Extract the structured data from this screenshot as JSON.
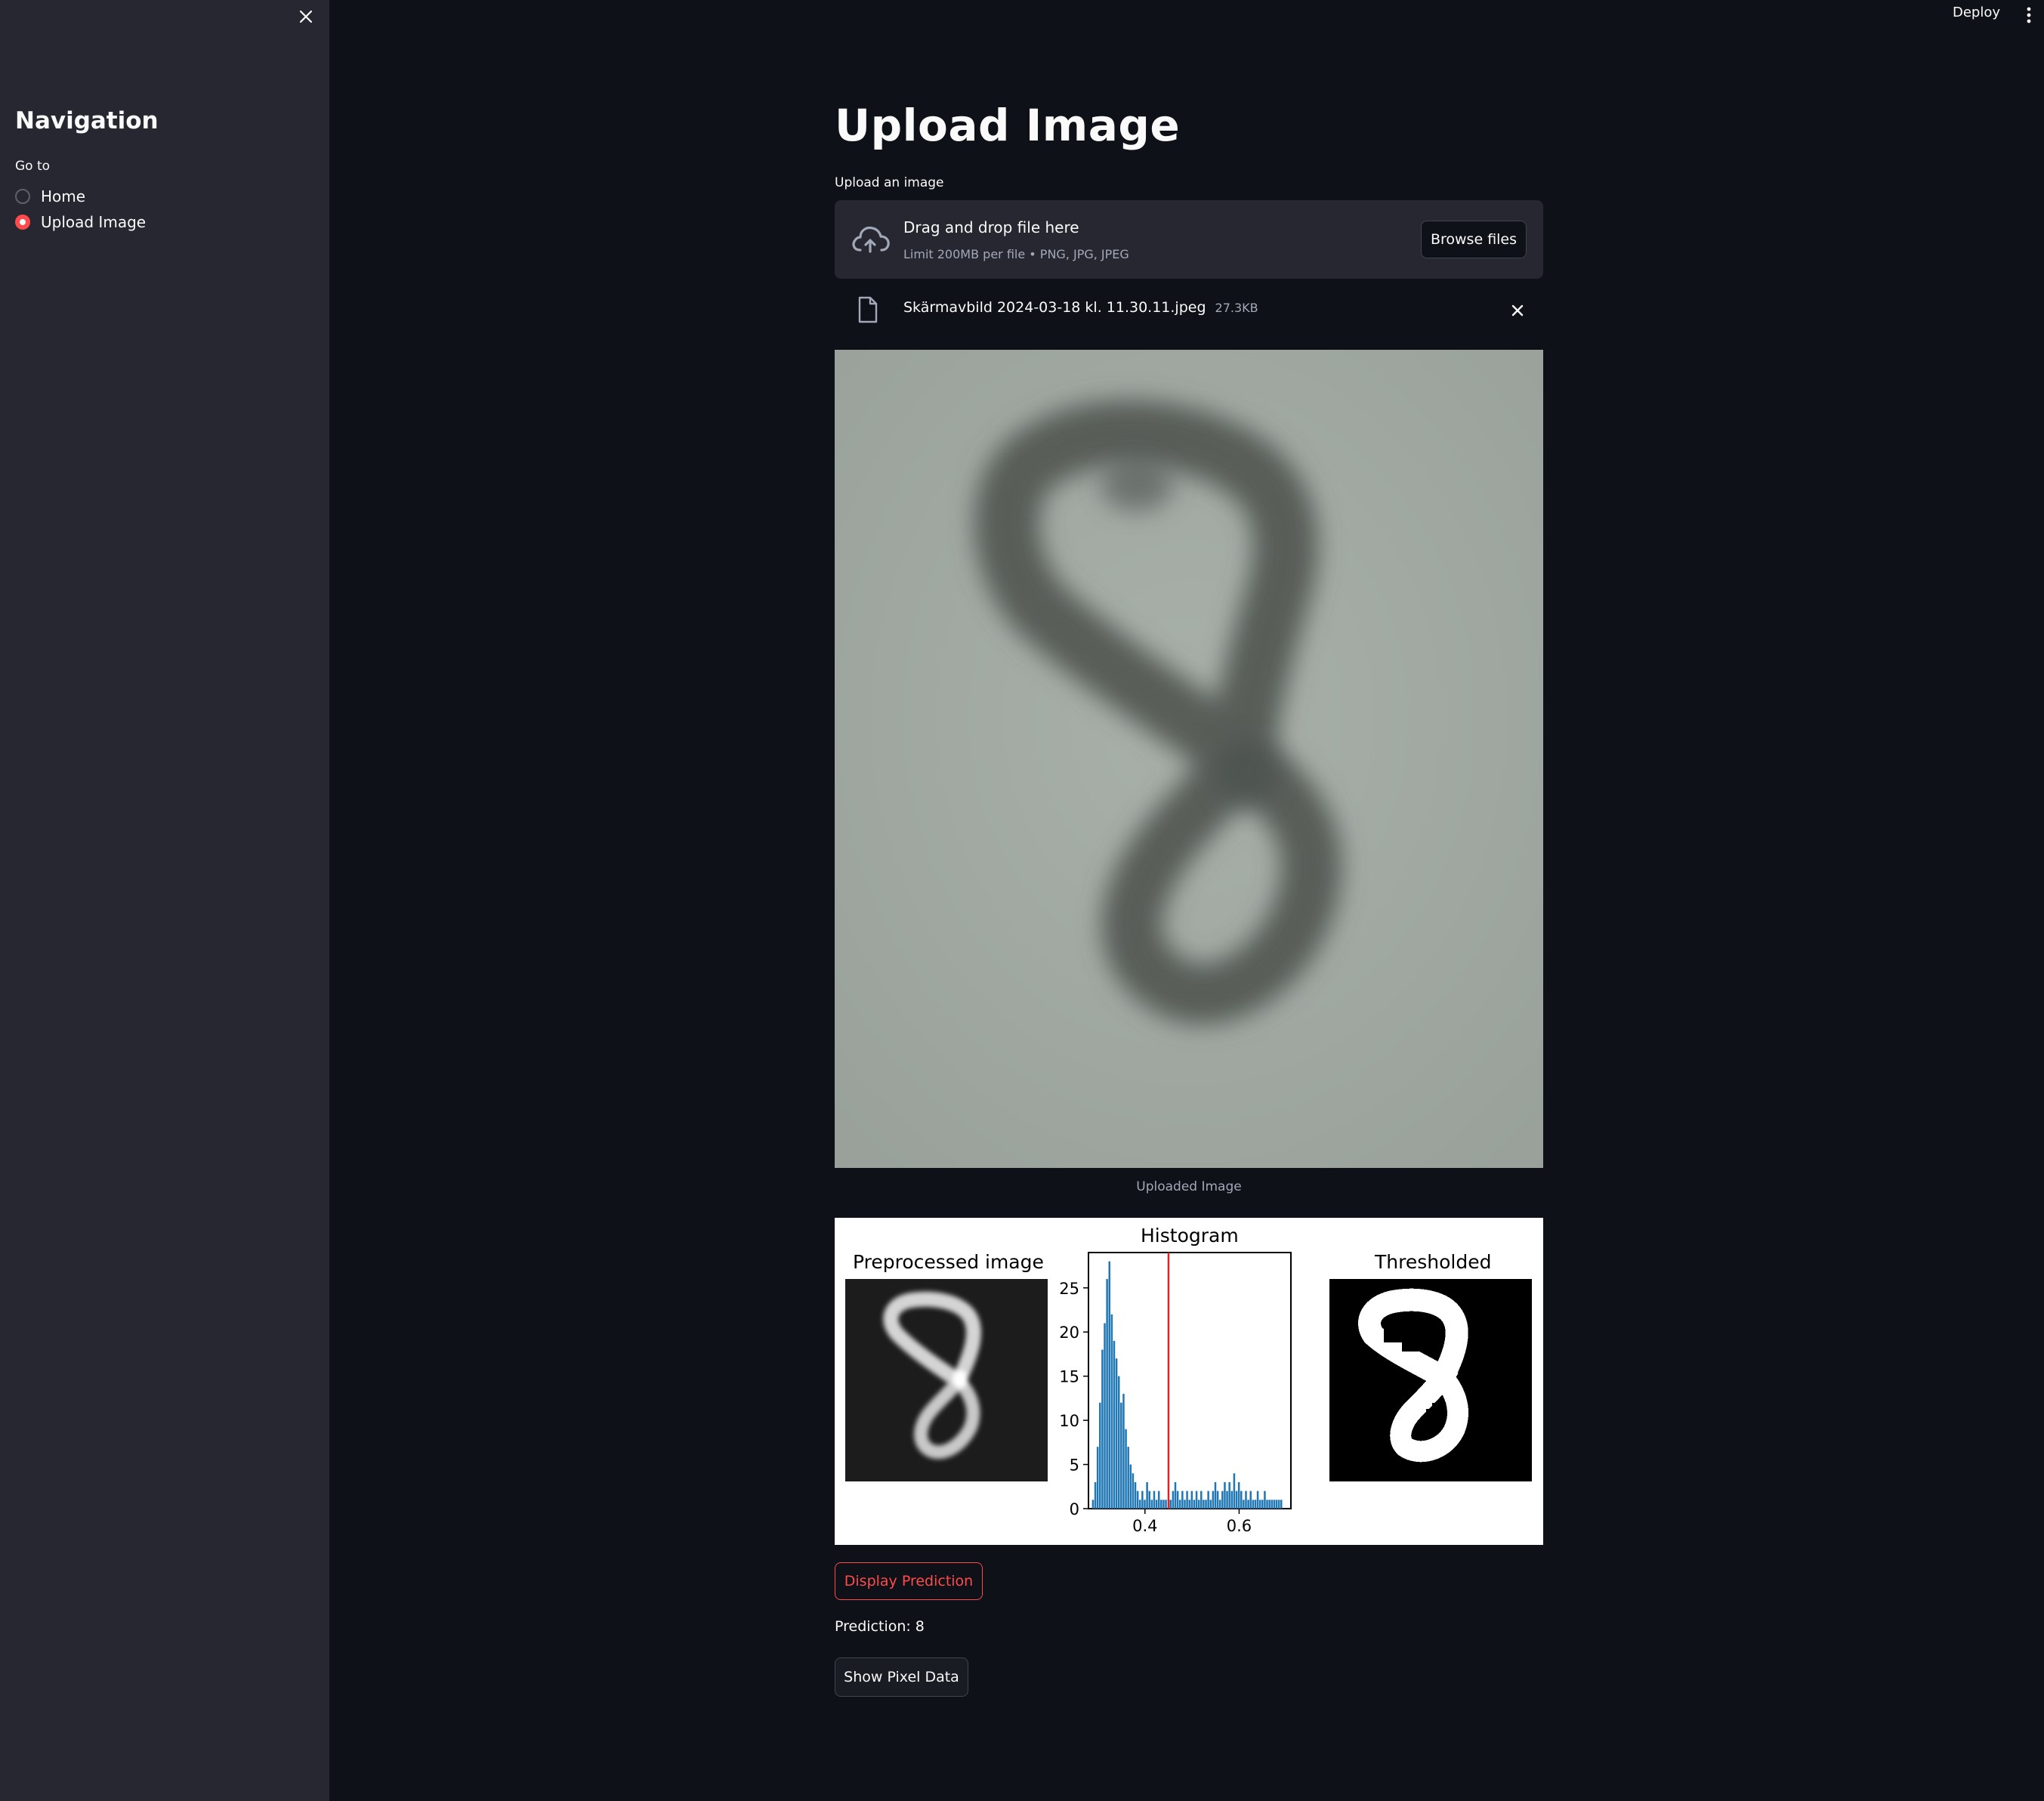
{
  "sidebar": {
    "close_icon": "close-icon",
    "title": "Navigation",
    "radio_label": "Go to",
    "options": [
      {
        "label": "Home",
        "selected": false
      },
      {
        "label": "Upload Image",
        "selected": true
      }
    ]
  },
  "header": {
    "deploy_label": "Deploy",
    "menu_icon": "kebab-menu-icon"
  },
  "main": {
    "title": "Upload Image",
    "uploader": {
      "label": "Upload an image",
      "drop_title": "Drag and drop file here",
      "drop_limit": "Limit 200MB per file • PNG, JPG, JPEG",
      "browse_label": "Browse files",
      "file_name": "Skärmavbild 2024-03-18 kl. 11.30.11.jpeg",
      "file_size": "27.3KB"
    },
    "image_caption": "Uploaded Image",
    "figure": {
      "titles": {
        "preprocessed": "Preprocessed image",
        "histogram": "Histogram",
        "thresholded": "Thresholded"
      }
    },
    "predict_button": "Display Prediction",
    "prediction_label": "Prediction:",
    "prediction_value": "8",
    "pixel_button": "Show Pixel Data"
  },
  "colors": {
    "background": "#0e1117",
    "sidebar": "#262730",
    "accent": "#ff4b4b",
    "histogram_bars": "#1f77b4",
    "threshold_line": "#d62728"
  },
  "chart_data": {
    "type": "bar",
    "title": "Histogram",
    "xlabel": "",
    "ylabel": "",
    "x_ticks": [
      "0.4",
      "0.6"
    ],
    "y_ticks": [
      "0",
      "5",
      "10",
      "15",
      "20",
      "25"
    ],
    "xlim": [
      0.28,
      0.71
    ],
    "ylim": [
      0,
      29
    ],
    "threshold": 0.45,
    "bins": [
      [
        0.29,
        1
      ],
      [
        0.295,
        3
      ],
      [
        0.3,
        7
      ],
      [
        0.305,
        12
      ],
      [
        0.31,
        18
      ],
      [
        0.315,
        21
      ],
      [
        0.32,
        26
      ],
      [
        0.325,
        28
      ],
      [
        0.33,
        22
      ],
      [
        0.335,
        19
      ],
      [
        0.34,
        17
      ],
      [
        0.345,
        15
      ],
      [
        0.35,
        12
      ],
      [
        0.355,
        13
      ],
      [
        0.36,
        9
      ],
      [
        0.365,
        7
      ],
      [
        0.37,
        5
      ],
      [
        0.375,
        4
      ],
      [
        0.38,
        3
      ],
      [
        0.385,
        2
      ],
      [
        0.39,
        1
      ],
      [
        0.395,
        2
      ],
      [
        0.4,
        1
      ],
      [
        0.405,
        3
      ],
      [
        0.41,
        2
      ],
      [
        0.415,
        1
      ],
      [
        0.42,
        2
      ],
      [
        0.425,
        1
      ],
      [
        0.43,
        2
      ],
      [
        0.435,
        1
      ],
      [
        0.44,
        1
      ],
      [
        0.445,
        1
      ],
      [
        0.455,
        1
      ],
      [
        0.46,
        2
      ],
      [
        0.465,
        3
      ],
      [
        0.47,
        2
      ],
      [
        0.475,
        1
      ],
      [
        0.48,
        2
      ],
      [
        0.485,
        1
      ],
      [
        0.49,
        2
      ],
      [
        0.495,
        1
      ],
      [
        0.5,
        2
      ],
      [
        0.505,
        1
      ],
      [
        0.51,
        2
      ],
      [
        0.515,
        1
      ],
      [
        0.52,
        2
      ],
      [
        0.525,
        1
      ],
      [
        0.53,
        1
      ],
      [
        0.535,
        2
      ],
      [
        0.54,
        1
      ],
      [
        0.545,
        2
      ],
      [
        0.55,
        3
      ],
      [
        0.555,
        2
      ],
      [
        0.56,
        1
      ],
      [
        0.565,
        2
      ],
      [
        0.57,
        3
      ],
      [
        0.575,
        2
      ],
      [
        0.58,
        3
      ],
      [
        0.585,
        2
      ],
      [
        0.59,
        4
      ],
      [
        0.595,
        2
      ],
      [
        0.6,
        3
      ],
      [
        0.605,
        2
      ],
      [
        0.61,
        1
      ],
      [
        0.615,
        2
      ],
      [
        0.62,
        1
      ],
      [
        0.625,
        2
      ],
      [
        0.63,
        1
      ],
      [
        0.635,
        1
      ],
      [
        0.64,
        2
      ],
      [
        0.645,
        1
      ],
      [
        0.65,
        1
      ],
      [
        0.655,
        2
      ],
      [
        0.66,
        1
      ],
      [
        0.665,
        1
      ],
      [
        0.67,
        1
      ],
      [
        0.675,
        1
      ],
      [
        0.68,
        1
      ],
      [
        0.685,
        1
      ],
      [
        0.69,
        1
      ]
    ]
  }
}
